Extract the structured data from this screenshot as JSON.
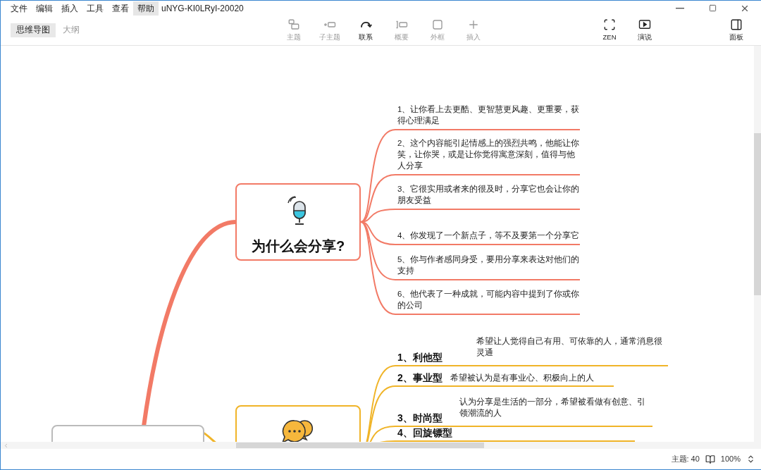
{
  "menu": [
    {
      "label": "文件",
      "highlighted": false
    },
    {
      "label": "编辑",
      "highlighted": false
    },
    {
      "label": "插入",
      "highlighted": false
    },
    {
      "label": "工具",
      "highlighted": false
    },
    {
      "label": "查看",
      "highlighted": false
    },
    {
      "label": "帮助",
      "highlighted": true
    }
  ],
  "title": "uNYG-KI0LRyI-20020",
  "view_tabs": [
    {
      "label": "思维导图",
      "selected": true
    },
    {
      "label": "大纲",
      "selected": false
    }
  ],
  "tools": [
    {
      "label": "主题",
      "kind": "topic",
      "disabled": true
    },
    {
      "label": "子主题",
      "kind": "subtopic",
      "disabled": true
    },
    {
      "label": "联系",
      "kind": "relation",
      "disabled": false
    },
    {
      "label": "概要",
      "kind": "summary",
      "disabled": true
    },
    {
      "label": "外框",
      "kind": "boundary",
      "disabled": true
    },
    {
      "label": "插入",
      "kind": "insert",
      "disabled": true
    }
  ],
  "view_tools": [
    {
      "label": "ZEN",
      "kind": "zen"
    },
    {
      "label": "演说",
      "kind": "pitch"
    }
  ],
  "panel_tool": {
    "label": "面板",
    "kind": "panel"
  },
  "mind_map": {
    "branches": [
      {
        "kind": "plain",
        "title": "为什么会分享?",
        "color": "#f27a66",
        "items": [
          {
            "text": "1、让你看上去更酷、更智慧更风趣、更重要，获得心理满足"
          },
          {
            "text": "2、这个内容能引起情感上的强烈共鸣，他能让你笑，让你哭，或是让你觉得寓意深刻，值得与他人分享"
          },
          {
            "text": "3、它很实用或者来的很及时，分享它也会让你的朋友受益"
          },
          {
            "text": "4、你发现了一个新点子，等不及要第一个分享它"
          },
          {
            "text": "5、你与作者感同身受，要用分享来表达对他们的支持"
          },
          {
            "text": "6、他代表了一种成就，可能内容中提到了你或你的公司"
          }
        ]
      },
      {
        "kind": "labeled",
        "color": "#f0b428",
        "items": [
          {
            "label": "1、利他型",
            "text": "希望让人觉得自己有用、可依靠的人，通常消息很灵通"
          },
          {
            "label": "2、事业型",
            "text": "希望被认为是有事业心、积极向上的人"
          },
          {
            "label": "3、时尚型",
            "text": "认为分享是生活的一部分，希望被看做有创意、引领潮流的人"
          },
          {
            "label": "4、回旋镖型"
          }
        ]
      }
    ]
  },
  "status": {
    "topics": "主题: 40",
    "zoom": "100%"
  }
}
